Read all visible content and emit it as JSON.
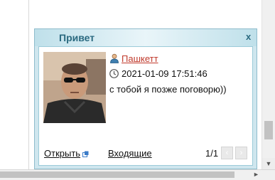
{
  "popup": {
    "title": "Привет",
    "close_label": "x",
    "sender_name": "Пашкетт",
    "timestamp": "2021-01-09 17:51:46",
    "message": "с тобой я позже поговорю))",
    "open_label": "Открыть",
    "inbox_label": "Входящие",
    "pager": "1/1",
    "prev_label": "‹",
    "next_label": "›"
  },
  "colors": {
    "header_text": "#2b6a80",
    "sender_link": "#c0392b",
    "frame": "#cfe6ee"
  },
  "icons": [
    "user-icon",
    "clock-icon",
    "external-link-icon",
    "chevron-left-icon",
    "chevron-right-icon"
  ]
}
